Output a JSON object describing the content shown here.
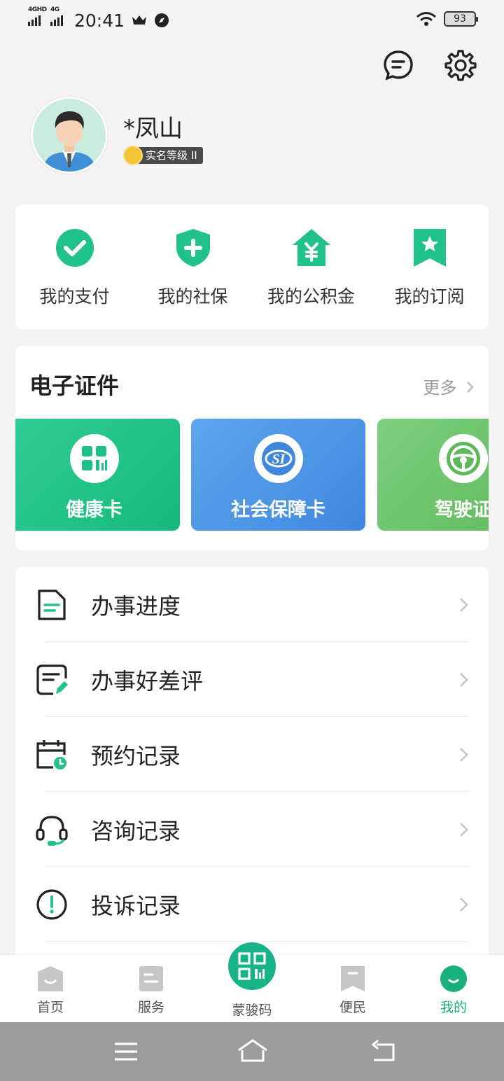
{
  "status": {
    "network1": "4GHD",
    "network2": "4G",
    "time": "20:41",
    "battery": "93"
  },
  "profile": {
    "name": "*凤山",
    "badge": "实名等级 II"
  },
  "quick_actions": [
    {
      "label": "我的支付",
      "icon": "check-circle-icon"
    },
    {
      "label": "我的社保",
      "icon": "shield-plus-icon"
    },
    {
      "label": "我的公积金",
      "icon": "house-yen-icon"
    },
    {
      "label": "我的订阅",
      "icon": "bookmark-star-icon"
    }
  ],
  "certificates": {
    "title": "电子证件",
    "more": "更多",
    "items": [
      {
        "label": "健康卡",
        "icon": "health-code-icon"
      },
      {
        "label": "社会保障卡",
        "icon": "social-security-icon"
      },
      {
        "label": "驾驶证",
        "icon": "steering-wheel-icon"
      }
    ]
  },
  "menu": [
    {
      "label": "办事进度",
      "icon": "document-icon"
    },
    {
      "label": "办事好差评",
      "icon": "review-edit-icon"
    },
    {
      "label": "预约记录",
      "icon": "calendar-clock-icon"
    },
    {
      "label": "咨询记录",
      "icon": "headset-icon"
    },
    {
      "label": "投诉记录",
      "icon": "alert-circle-icon"
    }
  ],
  "tabs": [
    {
      "label": "首页",
      "icon": "home-icon"
    },
    {
      "label": "服务",
      "icon": "service-icon"
    },
    {
      "label": "蒙骏码",
      "icon": "qr-code-icon"
    },
    {
      "label": "便民",
      "icon": "bookmark-icon"
    },
    {
      "label": "我的",
      "icon": "profile-icon"
    }
  ],
  "colors": {
    "accent": "#1aaf7e",
    "health_card": "#22c48b",
    "social_card": "#4a93e4",
    "drive_card": "#6cc26b",
    "navbar": "#9c9c9c"
  }
}
